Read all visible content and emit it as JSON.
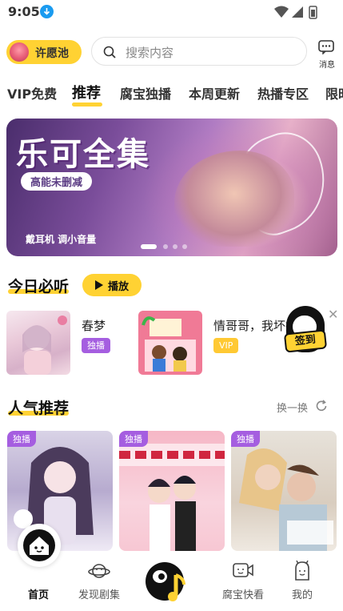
{
  "status_bar": {
    "time": "9:05"
  },
  "header": {
    "wish_pool_label": "许愿池",
    "search_placeholder": "搜索内容",
    "messages_label": "消息"
  },
  "tabs": [
    {
      "label": "VIP免费",
      "active": false
    },
    {
      "label": "推荐",
      "active": true
    },
    {
      "label": "腐宝独播",
      "active": false
    },
    {
      "label": "本周更新",
      "active": false
    },
    {
      "label": "热播专区",
      "active": false
    },
    {
      "label": "限时",
      "active": false
    }
  ],
  "banner": {
    "title": "乐可全集",
    "tag": "高能未删减",
    "note": "戴耳机 调小音量",
    "page_count": 4,
    "active_page": 1
  },
  "daily": {
    "title": "今日必听",
    "play_label": "播放",
    "items": [
      {
        "title": "春梦",
        "badge": "独播",
        "badge_type": "exclusive"
      },
      {
        "title": "情哥哥，我坏掉",
        "badge": "VIP",
        "badge_type": "vip"
      }
    ]
  },
  "checkin": {
    "label": "签到"
  },
  "popular": {
    "title": "人气推荐",
    "refresh_label": "换一换",
    "cards": [
      {
        "badge": "独播"
      },
      {
        "badge": "独播"
      },
      {
        "badge": "独播"
      }
    ]
  },
  "bottom_nav": {
    "items": [
      {
        "label": "首页",
        "active": true,
        "icon": "home-icon"
      },
      {
        "label": "发现剧集",
        "active": false,
        "icon": "planet-icon"
      },
      {
        "label": "",
        "active": false,
        "icon": "music-mascot-icon"
      },
      {
        "label": "腐宝快看",
        "active": false,
        "icon": "video-icon"
      },
      {
        "label": "我的",
        "active": false,
        "icon": "mascot-profile-icon"
      }
    ]
  },
  "colors": {
    "accent": "#ffd233",
    "exclusive": "#a55ee0",
    "vip": "#ffc933"
  }
}
